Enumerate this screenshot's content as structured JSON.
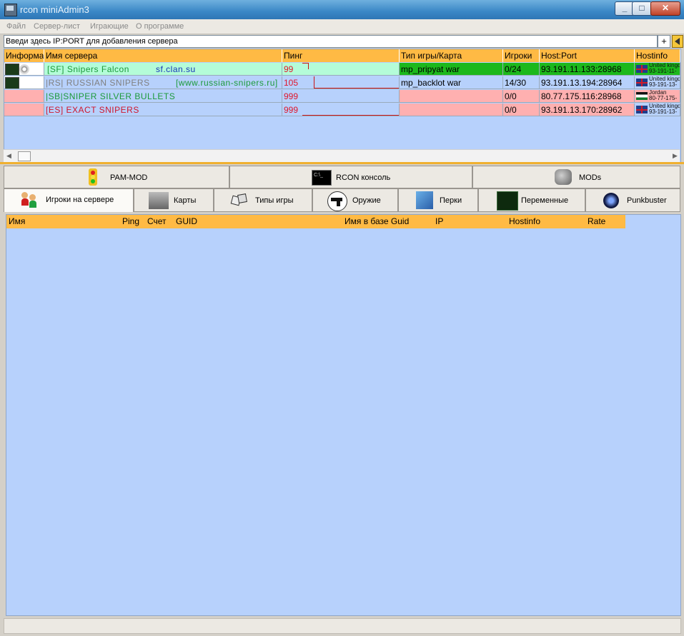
{
  "window": {
    "title": "rcon miniAdmin3"
  },
  "menu": [
    "Файл",
    "Сервер-лист",
    "Играющие",
    "О программе"
  ],
  "address": {
    "value": "Введи здесь IP:PORT для добавления сервера",
    "add_label": "+"
  },
  "server_table": {
    "columns": [
      "Информа",
      "Имя сервера",
      "Пинг",
      "Тип игры/Карта",
      "Игроки",
      "Host:Port",
      "Hostinfo"
    ],
    "rows": [
      {
        "name": "[SF] Snipers Falcon",
        "site": "sf.clan.su",
        "ping": "99",
        "map": "mp_pripyat war",
        "players": "0/24",
        "host": "93.191.11.133:28968",
        "country": "United kingdom",
        "hostinfo": "93-191-11-"
      },
      {
        "name": "|RS| RUSSIAN SNIPERS",
        "site": "[www.russian-snipers.ru]",
        "ping": "105",
        "map": "mp_backlot war",
        "players": "14/30",
        "host": "93.191.13.194:28964",
        "country": "United kingdom",
        "hostinfo": "93-191-13-"
      },
      {
        "name": "|SB|SNIPER SILVER BULLETS",
        "site": "",
        "ping": "999",
        "map": "",
        "players": "0/0",
        "host": "80.77.175.116:28968",
        "country": "Jordan",
        "hostinfo": "80-77-175-"
      },
      {
        "name": "[ES] EXACT SNIPERS",
        "site": "",
        "ping": "999",
        "map": "",
        "players": "0/0",
        "host": "93.191.13.170:28962",
        "country": "United kingdom",
        "hostinfo": "93-191-13-"
      }
    ]
  },
  "tabs_top": [
    "PAM-MOD",
    "RCON консоль",
    "MODs"
  ],
  "tabs_bottom": [
    "Игроки на сервере",
    "Карты",
    "Типы игры",
    "Оружие",
    "Перки",
    "Переменные",
    "Punkbuster"
  ],
  "players_table": {
    "columns": [
      "Имя",
      "Ping",
      "Счет",
      "GUID",
      "Имя в базе Guid",
      "IP",
      "Hostinfo",
      "Rate"
    ]
  },
  "colors": {
    "header": "#ffba44",
    "grid_bg": "#b7d1fc",
    "row_online": "#b4fcd8",
    "row_offline": "#ffb0b0",
    "ping_text": "#e0162b",
    "selection": "#1cb81c"
  },
  "icons": [
    "app-icon",
    "info-icon",
    "settings-icon",
    "traffic-light-icon",
    "console-icon",
    "puzzle-icon",
    "users-icon",
    "map-icon",
    "dice-icon",
    "pistol-icon",
    "gift-icon",
    "variables-icon",
    "punkbuster-icon",
    "uk-flag-icon",
    "jordan-flag-icon"
  ]
}
